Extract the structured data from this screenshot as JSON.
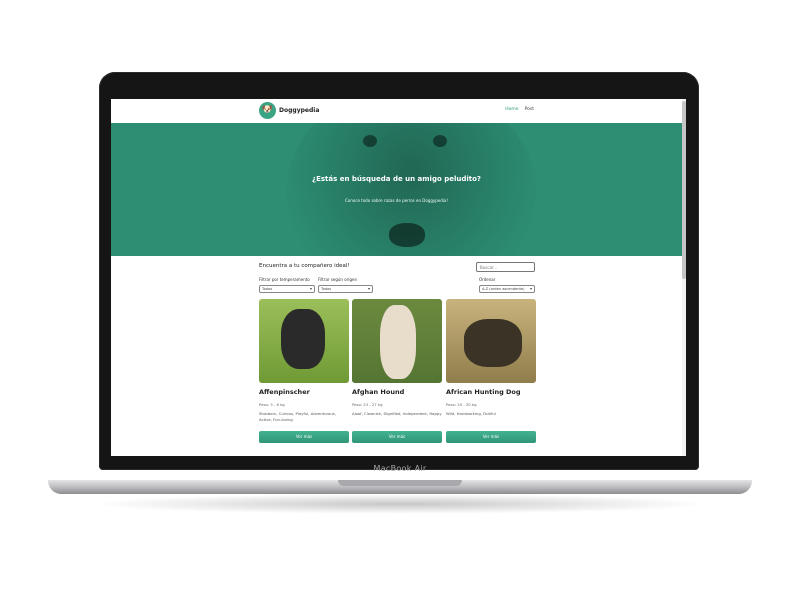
{
  "device": {
    "label": "MacBook Air"
  },
  "navbar": {
    "logo_glyph": "🐶",
    "site_name": "Doggypedia",
    "links": [
      "Home",
      "Post"
    ]
  },
  "hero": {
    "title": "¿Estás en búsqueda de un amigo peludito?",
    "subtitle": "Conoce todo sobre razas de perros en Doggypedia!"
  },
  "filters": {
    "title": "Encuentra a tu compañero ideal!",
    "search_placeholder": "Buscar...",
    "temperament_label": "Filtrar por temperamento",
    "temperament_value": "Todos",
    "origin_label": "Filtrar según origen",
    "origin_value": "Todos",
    "order_label": "Ordenar",
    "order_value": "A-Z (orden ascendente)"
  },
  "cards": [
    {
      "name": "Affenpinscher",
      "weight": "Peso: 3 - 6 kg",
      "temperament": "Stubborn, Curious, Playful, Adventurous, Active, Fun-loving",
      "button": "Ver más"
    },
    {
      "name": "Afghan Hound",
      "weight": "Peso: 23 - 27 kg",
      "temperament": "Aloof, Clownish, Dignified, Independent, Happy",
      "button": "Ver más"
    },
    {
      "name": "African Hunting Dog",
      "weight": "Peso: 20 - 30 kg",
      "temperament": "Wild, Hardworking, Dutiful",
      "button": "Ver más"
    }
  ],
  "colors": {
    "accent": "#3aa585",
    "hero_overlay": "#2d8e74"
  }
}
